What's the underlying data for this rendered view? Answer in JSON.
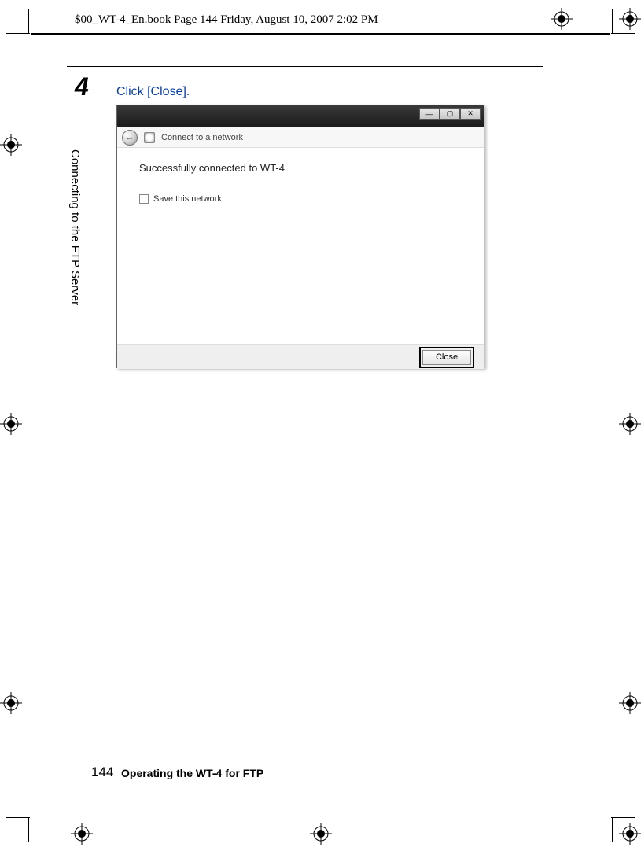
{
  "header": {
    "text": "$00_WT-4_En.book  Page 144  Friday, August 10, 2007  2:02 PM"
  },
  "step": {
    "number": "4",
    "instruction": "Click [Close]."
  },
  "sidebar": {
    "section": "Connecting to the FTP Server"
  },
  "footer": {
    "page_number": "144",
    "title": "Operating the WT-4 for FTP"
  },
  "window": {
    "title": "Connect to a network",
    "message": "Successfully connected to WT-4",
    "save_label": "Save this network",
    "close_label": "Close",
    "controls": {
      "min": "—",
      "max": "▢",
      "close": "✕"
    },
    "back_arrow": "←"
  }
}
